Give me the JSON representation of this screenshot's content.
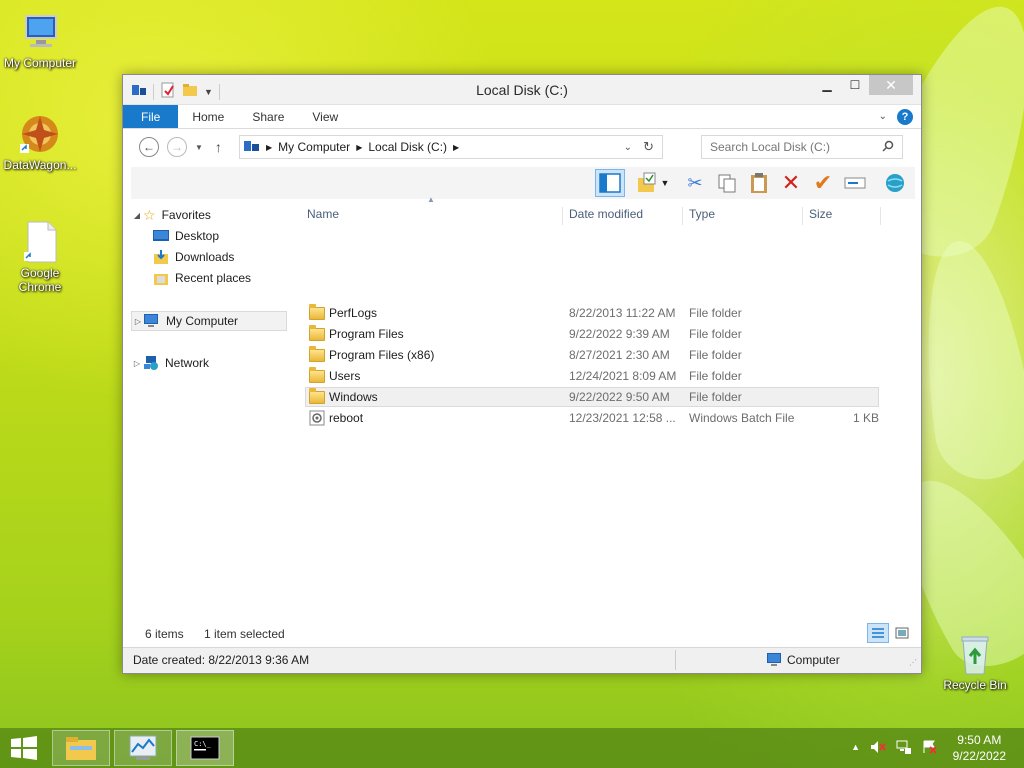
{
  "desktop": {
    "icons": [
      {
        "label": "My Computer",
        "icon": "my-computer-icon"
      },
      {
        "label": "DataWagon...",
        "icon": "datawagon-icon"
      },
      {
        "label": "Google Chrome",
        "icon": "document-shortcut-icon"
      },
      {
        "label": "Recycle Bin",
        "icon": "recycle-bin-icon"
      }
    ]
  },
  "window": {
    "title": "Local Disk (C:)",
    "tabs": {
      "file": "File",
      "home": "Home",
      "share": "Share",
      "view": "View"
    },
    "address": {
      "segment1": "My Computer",
      "segment2": "Local Disk (C:)"
    },
    "search_placeholder": "Search Local Disk (C:)",
    "navigation": {
      "favorites": "Favorites",
      "desktop": "Desktop",
      "downloads": "Downloads",
      "recent": "Recent places",
      "computer": "My Computer",
      "network": "Network"
    },
    "columns": {
      "name": "Name",
      "date": "Date modified",
      "type": "Type",
      "size": "Size"
    },
    "files": [
      {
        "name": "PerfLogs",
        "date": "8/22/2013 11:22 AM",
        "type": "File folder",
        "size": "",
        "icon": "folder-icon"
      },
      {
        "name": "Program Files",
        "date": "9/22/2022 9:39 AM",
        "type": "File folder",
        "size": "",
        "icon": "folder-icon"
      },
      {
        "name": "Program Files (x86)",
        "date": "8/27/2021 2:30 AM",
        "type": "File folder",
        "size": "",
        "icon": "folder-icon"
      },
      {
        "name": "Users",
        "date": "12/24/2021 8:09 AM",
        "type": "File folder",
        "size": "",
        "icon": "folder-icon"
      },
      {
        "name": "Windows",
        "date": "9/22/2022 9:50 AM",
        "type": "File folder",
        "size": "",
        "icon": "folder-icon"
      },
      {
        "name": "reboot",
        "date": "12/23/2021 12:58 ...",
        "type": "Windows Batch File",
        "size": "1 KB",
        "icon": "batch-file-icon"
      }
    ],
    "status": {
      "items": "6 items",
      "selected": "1 item selected"
    },
    "details": {
      "created": "Date created: 8/22/2013 9:36 AM",
      "location": "Computer"
    }
  },
  "taskbar": {
    "time": "9:50 AM",
    "date": "9/22/2022"
  },
  "colors": {
    "accent": "#1979ca",
    "taskbar": "#5a8c1e"
  }
}
